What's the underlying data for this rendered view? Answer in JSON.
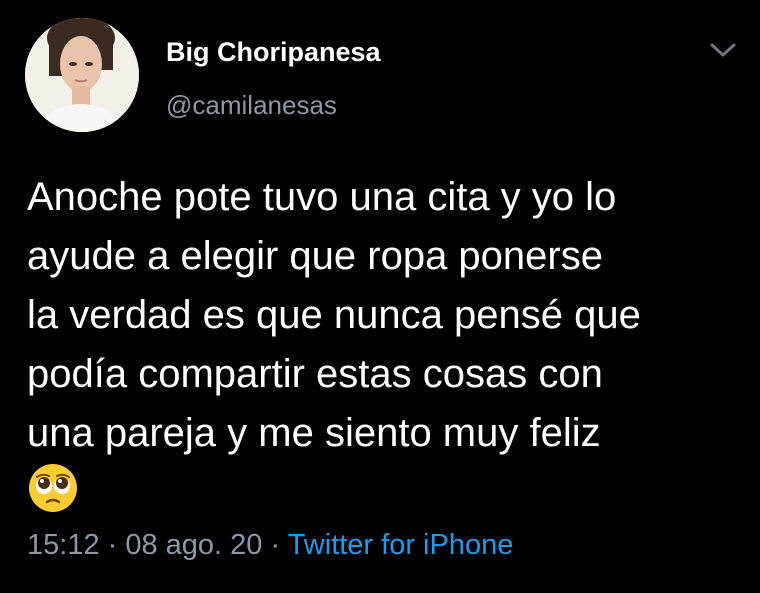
{
  "user": {
    "display_name": "Big Choripanesa",
    "handle": "@camilanesas"
  },
  "tweet": {
    "lines": [
      "Anoche pote tuvo una cita y yo lo",
      "ayude a elegir que ropa ponerse",
      "la verdad es que nunca pensé que",
      "podía compartir estas cosas con",
      "una pareja y me siento muy feliz"
    ],
    "emoji": "pleading-face"
  },
  "meta": {
    "time": "15:12",
    "separator": " · ",
    "date": "08 ago. 20",
    "source": "Twitter for iPhone"
  },
  "icons": {
    "menu": "chevron-down-icon"
  },
  "colors": {
    "background": "#000000",
    "text": "#ffffff",
    "secondary": "#8b98a5",
    "link": "#1d9bf0"
  }
}
